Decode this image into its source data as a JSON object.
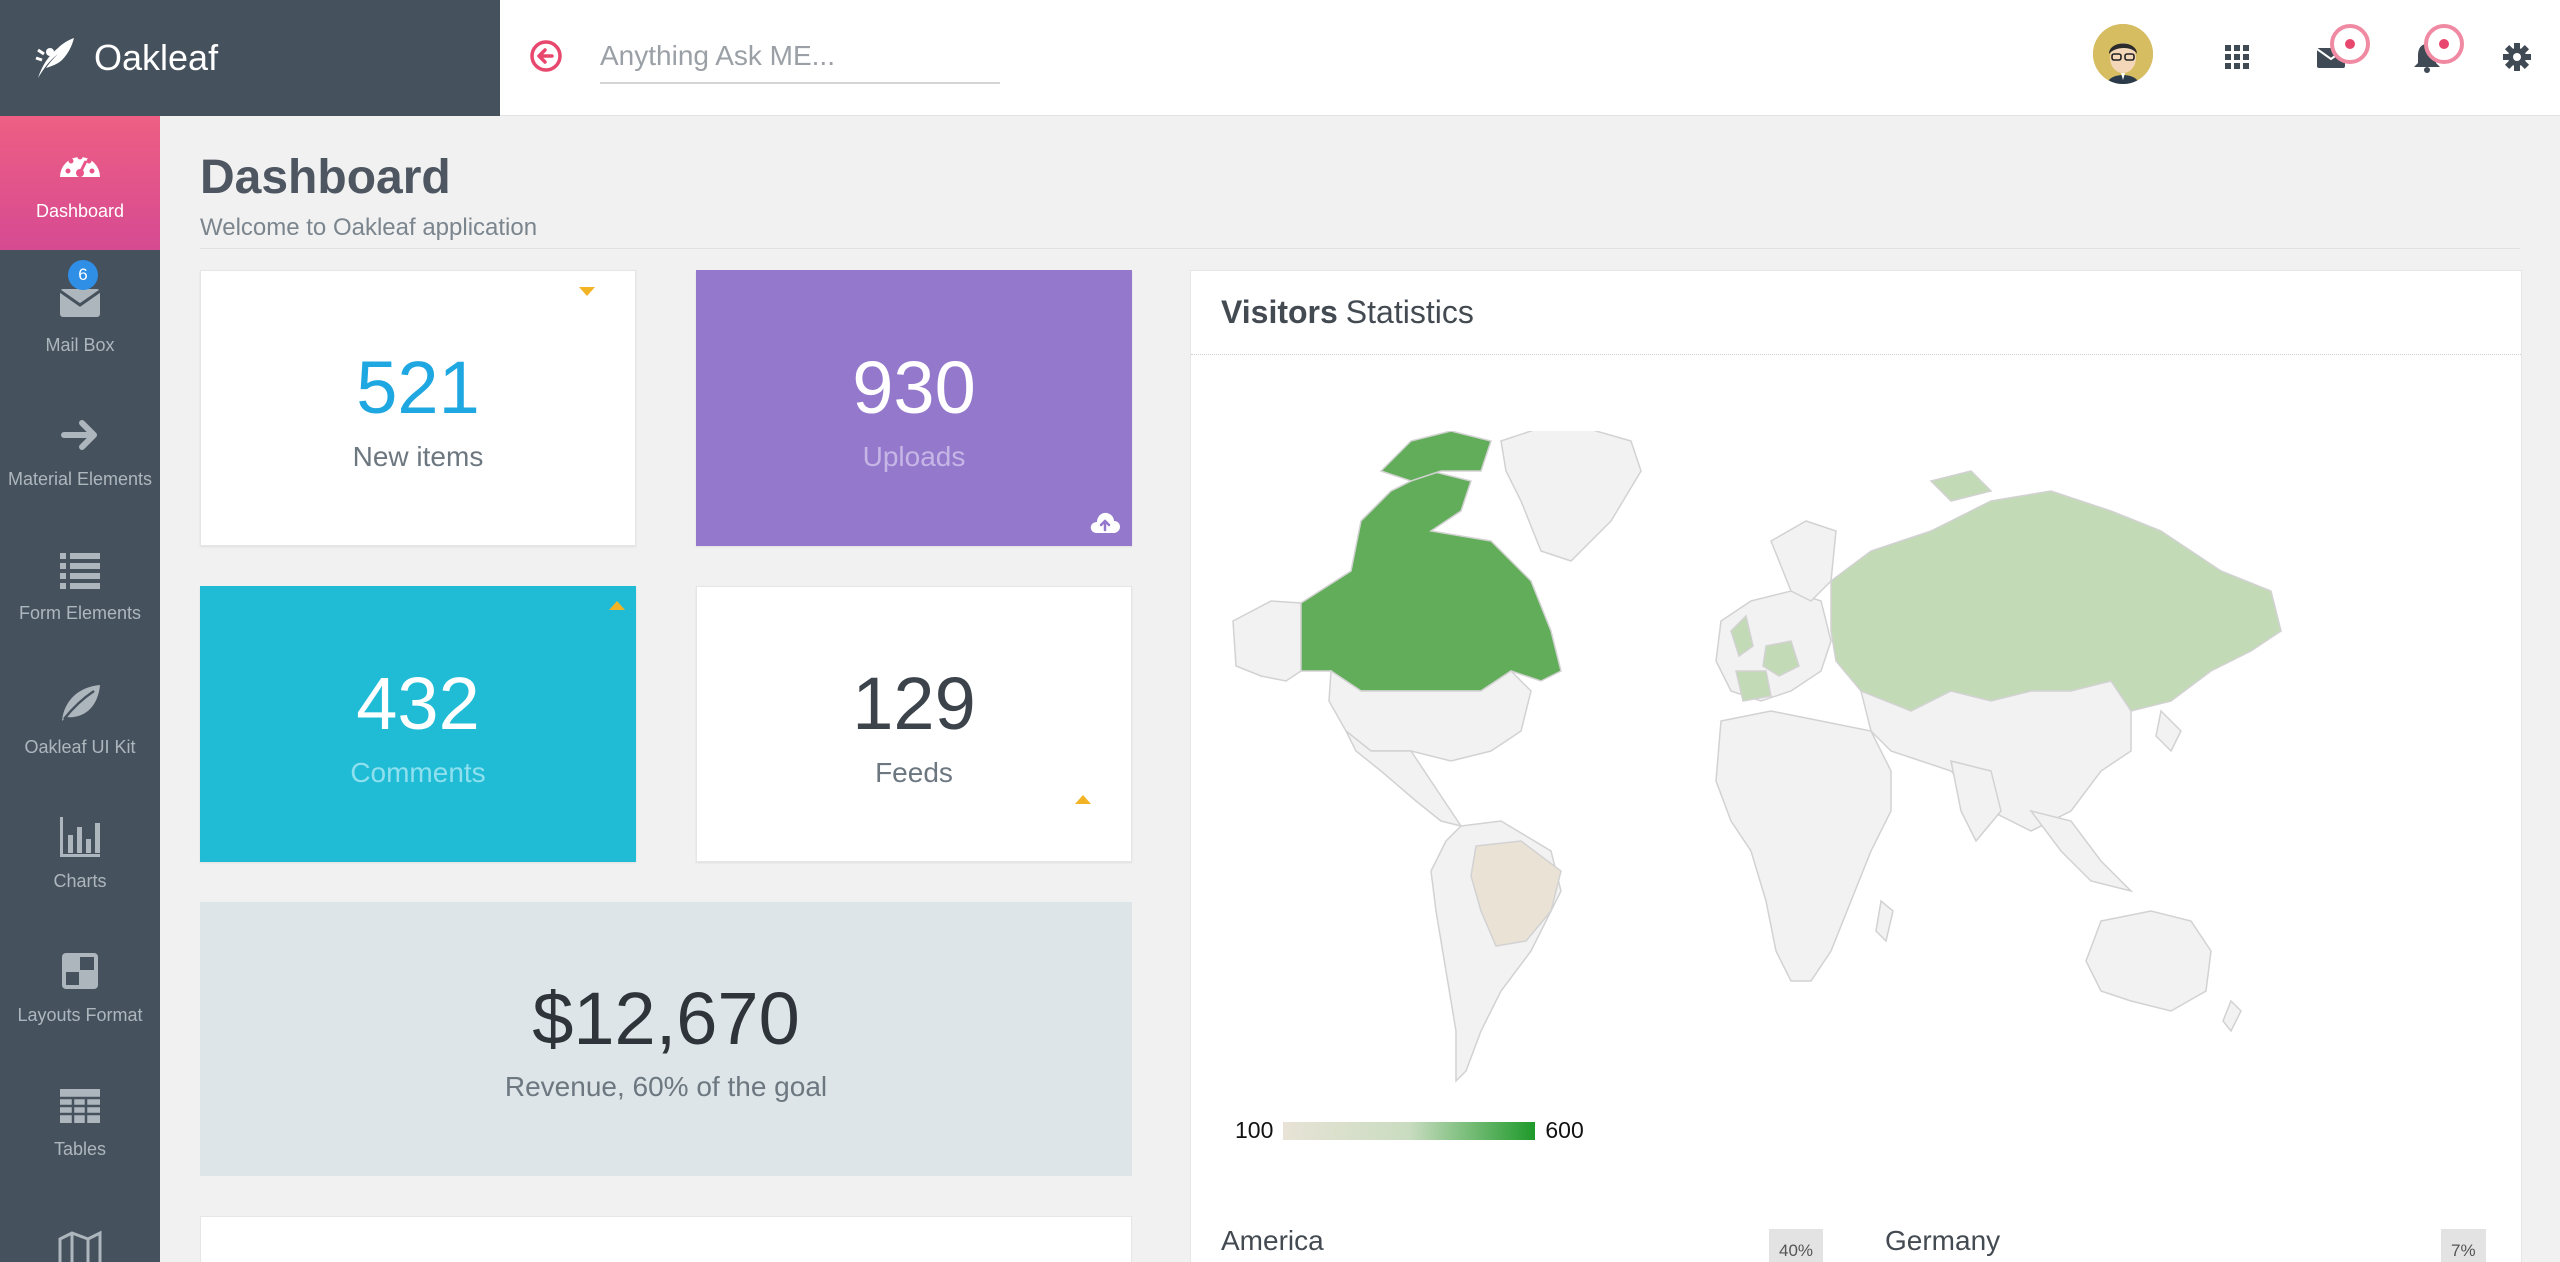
{
  "brand": {
    "name": "Oakleaf"
  },
  "search": {
    "placeholder": "Anything Ask ME..."
  },
  "sidebar": {
    "items": [
      {
        "label": "Dashboard",
        "icon": "dashboard-gauge-icon",
        "active": true
      },
      {
        "label": "Mail Box",
        "icon": "envelope-icon",
        "badge": "6"
      },
      {
        "label": "Material Elements",
        "icon": "arrow-right-icon"
      },
      {
        "label": "Form Elements",
        "icon": "list-icon"
      },
      {
        "label": "Oakleaf UI Kit",
        "icon": "leaf-icon"
      },
      {
        "label": "Charts",
        "icon": "bar-chart-icon"
      },
      {
        "label": "Layouts Format",
        "icon": "layout-grid-icon"
      },
      {
        "label": "Tables",
        "icon": "table-icon"
      }
    ]
  },
  "header": {
    "title": "Dashboard",
    "subtitle": "Welcome to Oakleaf application"
  },
  "stats": {
    "new_items": {
      "value": "521",
      "label": "New items"
    },
    "uploads": {
      "value": "930",
      "label": "Uploads"
    },
    "comments": {
      "value": "432",
      "label": "Comments"
    },
    "feeds": {
      "value": "129",
      "label": "Feeds"
    },
    "revenue": {
      "value": "$12,670",
      "label": "Revenue, 60% of the goal"
    }
  },
  "visitors": {
    "title_bold": "Visitors",
    "title_rest": "Statistics",
    "legend_min": "100",
    "legend_max": "600",
    "countries": [
      {
        "name": "America",
        "percent": "40%"
      },
      {
        "name": "Germany",
        "percent": "7%"
      }
    ]
  },
  "colors": {
    "sidebar": "#45525e",
    "active": "#e9558a",
    "new_items": "#1ea7e1",
    "uploads": "#9478cc",
    "comments": "#20bcd6",
    "revenue_bg": "#dde5e8",
    "map_high": "#1e9a2a",
    "map_low": "#e8e3d6"
  }
}
